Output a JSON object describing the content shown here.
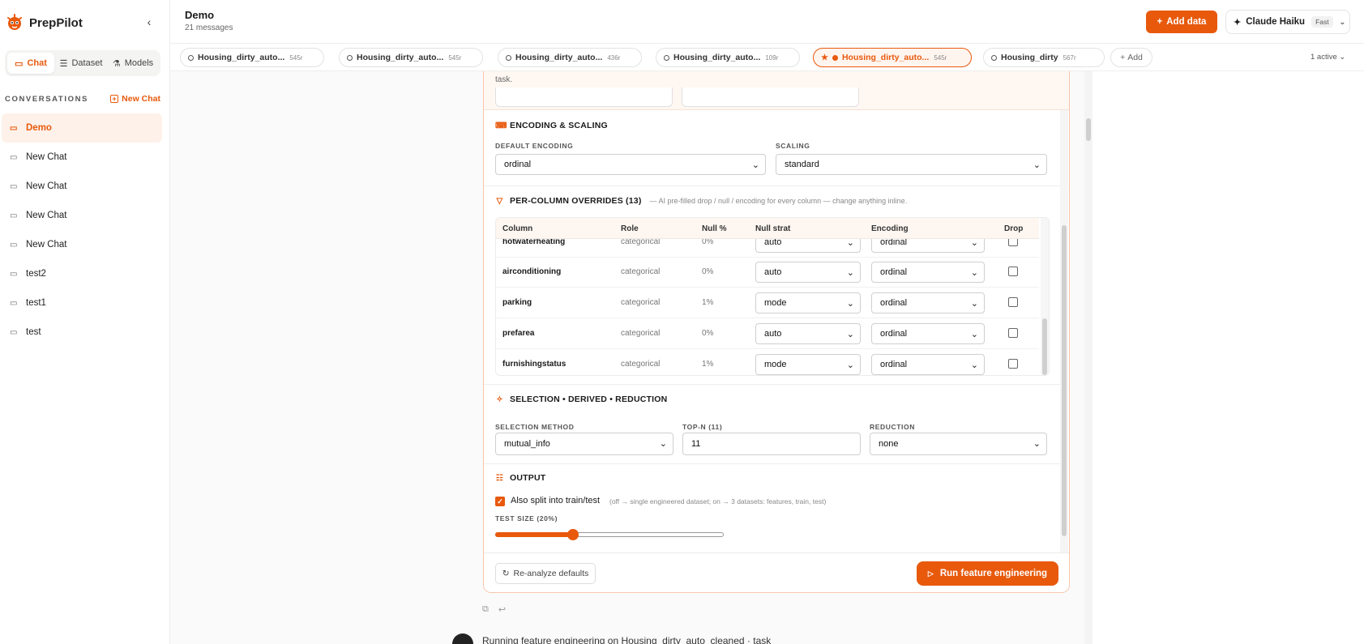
{
  "app": {
    "name": "PrepPilot"
  },
  "sidebar": {
    "tabs": [
      {
        "label": "Chat"
      },
      {
        "label": "Dataset"
      },
      {
        "label": "Models"
      }
    ],
    "conversations_label": "CONVERSATIONS",
    "new_chat_label": "New Chat",
    "items": [
      {
        "label": "Demo"
      },
      {
        "label": "New Chat"
      },
      {
        "label": "New Chat"
      },
      {
        "label": "New Chat"
      },
      {
        "label": "New Chat"
      },
      {
        "label": "test2"
      },
      {
        "label": "test1"
      },
      {
        "label": "test"
      }
    ]
  },
  "header": {
    "title": "Demo",
    "subtitle": "21 messages",
    "add_data_label": "Add data",
    "model_name": "Claude Haiku",
    "model_badge": "Fast"
  },
  "dataset_tabs": [
    {
      "label": "Housing_dirty_auto...",
      "count": "545r"
    },
    {
      "label": "Housing_dirty_auto...",
      "count": "545r"
    },
    {
      "label": "Housing_dirty_auto...",
      "count": "436r"
    },
    {
      "label": "Housing_dirty_auto...",
      "count": "109r"
    },
    {
      "label": "Housing_dirty_auto...",
      "count": "545r"
    },
    {
      "label": "Housing_dirty",
      "count": "567r"
    }
  ],
  "dataset_add_label": "Add",
  "dataset_active": "1 active",
  "card": {
    "task_text": "task.",
    "encoding_section": {
      "title": "ENCODING & SCALING",
      "default_encoding_label": "DEFAULT ENCODING",
      "default_encoding_value": "ordinal",
      "scaling_label": "SCALING",
      "scaling_value": "standard"
    },
    "overrides_section": {
      "title": "PER-COLUMN OVERRIDES (13)",
      "hint": "— AI pre-filled drop / null / encoding for every column — change anything inline.",
      "headers": {
        "column": "Column",
        "role": "Role",
        "null_pct": "Null %",
        "null_strat": "Null strat",
        "encoding": "Encoding",
        "drop": "Drop"
      },
      "rows": [
        {
          "column": "hotwaterheating",
          "role": "categorical",
          "null_pct": "0%",
          "null_strat": "auto",
          "encoding": "ordinal"
        },
        {
          "column": "airconditioning",
          "role": "categorical",
          "null_pct": "0%",
          "null_strat": "auto",
          "encoding": "ordinal"
        },
        {
          "column": "parking",
          "role": "categorical",
          "null_pct": "1%",
          "null_strat": "mode",
          "encoding": "ordinal"
        },
        {
          "column": "prefarea",
          "role": "categorical",
          "null_pct": "0%",
          "null_strat": "auto",
          "encoding": "ordinal"
        },
        {
          "column": "furnishingstatus",
          "role": "categorical",
          "null_pct": "1%",
          "null_strat": "mode",
          "encoding": "ordinal"
        }
      ]
    },
    "selection_section": {
      "title": "SELECTION • DERIVED • REDUCTION",
      "method_label": "SELECTION METHOD",
      "method_value": "mutual_info",
      "topn_label": "TOP-N (11)",
      "topn_value": "11",
      "reduction_label": "REDUCTION",
      "reduction_value": "none"
    },
    "output_section": {
      "title": "OUTPUT",
      "split_label": "Also split into train/test",
      "split_hint": "(off → single engineered dataset; on → 3 datasets: features, train, test)",
      "split_checked": true,
      "test_size_label": "TEST SIZE (20%)",
      "test_size_fraction": 0.2
    },
    "reanalyze_label": "Re-analyze defaults",
    "run_label": "Run feature engineering"
  },
  "next_message": "Running feature engineering on Housing_dirty_auto_cleaned · task"
}
